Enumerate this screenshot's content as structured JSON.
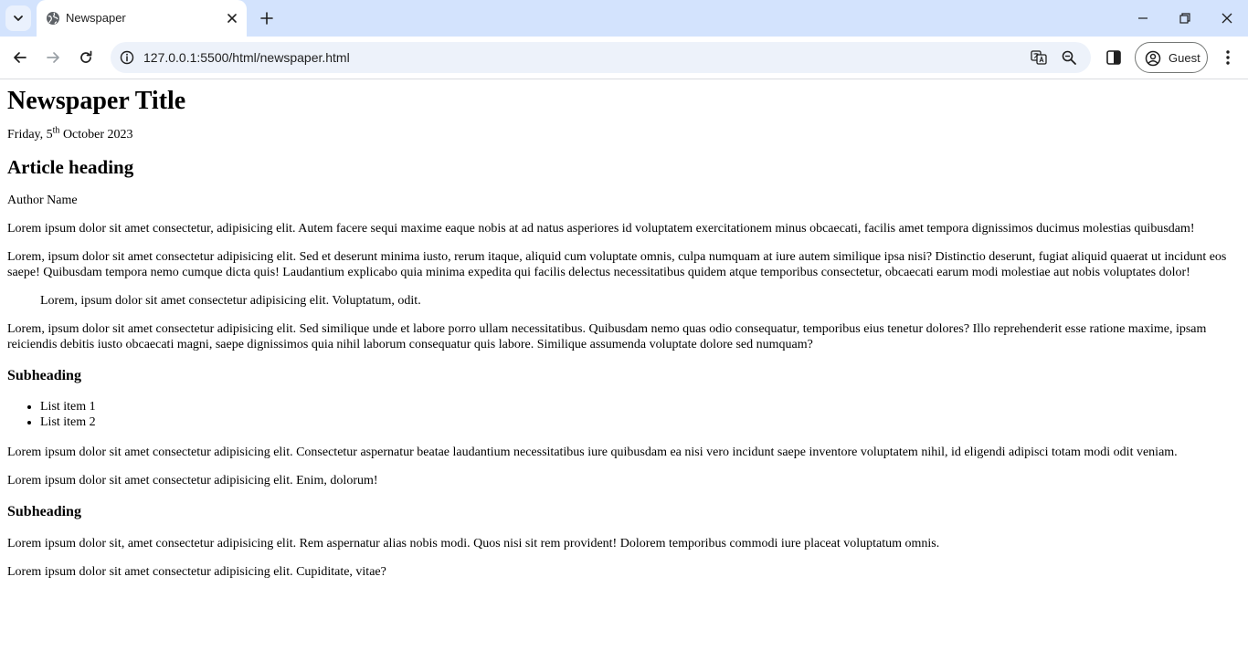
{
  "browser": {
    "tab": {
      "title": "Newspaper"
    },
    "url": "127.0.0.1:5500/html/newspaper.html",
    "profile_label": "Guest",
    "colors": {
      "tabstrip": "#d3e3fd",
      "omnibox": "#edf2fa"
    }
  },
  "article": {
    "newspaper_title": "Newspaper Title",
    "date": {
      "prefix": "Friday, 5",
      "sup": "th",
      "suffix": " October 2023"
    },
    "heading": "Article heading",
    "author": "Author Name",
    "paragraph_1": "Lorem ipsum dolor sit amet consectetur, adipisicing elit. Autem facere sequi maxime eaque nobis at ad natus asperiores id voluptatem exercitationem minus obcaecati, facilis amet tempora dignissimos ducimus molestias quibusdam!",
    "paragraph_2": "Lorem, ipsum dolor sit amet consectetur adipisicing elit. Sed et deserunt minima iusto, rerum itaque, aliquid cum voluptate omnis, culpa numquam at iure autem similique ipsa nisi? Distinctio deserunt, fugiat aliquid quaerat ut incidunt eos saepe! Quibusdam tempora nemo cumque dicta quis! Laudantium explicabo quia minima expedita qui facilis delectus necessitatibus quidem atque temporibus consectetur, obcaecati earum modi molestiae aut nobis voluptates dolor!",
    "quote": "Lorem, ipsum dolor sit amet consectetur adipisicing elit. Voluptatum, odit.",
    "paragraph_3": "Lorem, ipsum dolor sit amet consectetur adipisicing elit. Sed similique unde et labore porro ullam necessitatibus. Quibusdam nemo quas odio consequatur, temporibus eius tenetur dolores? Illo reprehenderit esse ratione maxime, ipsam reiciendis debitis iusto obcaecati magni, saepe dignissimos quia nihil laborum consequatur quis labore. Similique assumenda voluptate dolore sed numquam?",
    "subheading_1": "Subheading",
    "list_items": [
      "List item 1",
      "List item 2"
    ],
    "paragraph_4": "Lorem ipsum dolor sit amet consectetur adipisicing elit. Consectetur aspernatur beatae laudantium necessitatibus iure quibusdam ea nisi vero incidunt saepe inventore voluptatem nihil, id eligendi adipisci totam modi odit veniam.",
    "paragraph_5": "Lorem ipsum dolor sit amet consectetur adipisicing elit. Enim, dolorum!",
    "subheading_2": "Subheading",
    "paragraph_6": "Lorem ipsum dolor sit, amet consectetur adipisicing elit. Rem aspernatur alias nobis modi. Quos nisi sit rem provident! Dolorem temporibus commodi iure placeat voluptatum omnis.",
    "paragraph_7": "Lorem ipsum dolor sit amet consectetur adipisicing elit. Cupiditate, vitae?"
  }
}
